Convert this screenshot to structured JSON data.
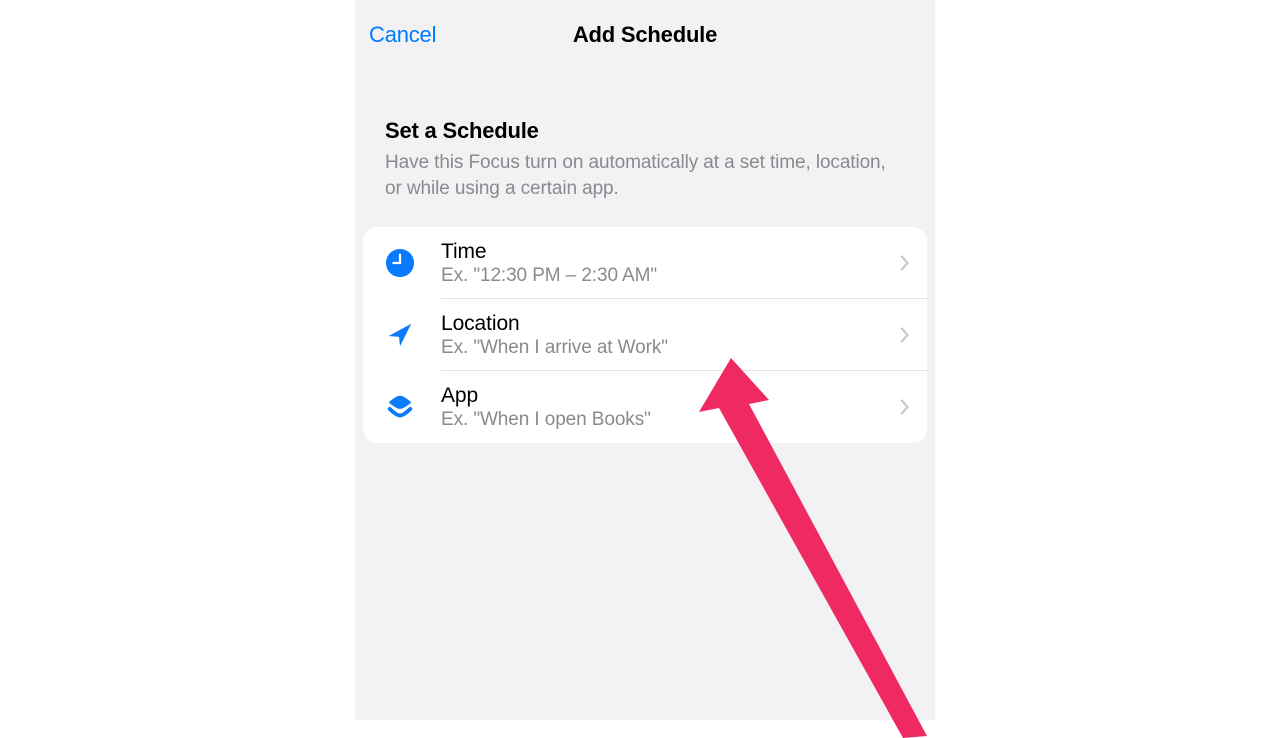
{
  "header": {
    "cancel_label": "Cancel",
    "title": "Add Schedule"
  },
  "section": {
    "title": "Set a Schedule",
    "description": "Have this Focus turn on automatically at a set time, location, or while using a certain app."
  },
  "rows": [
    {
      "title": "Time",
      "subtitle": "Ex. \"12:30 PM – 2:30 AM\"",
      "icon_name": "clock-icon"
    },
    {
      "title": "Location",
      "subtitle": "Ex. \"When I arrive at Work\"",
      "icon_name": "location-arrow-icon"
    },
    {
      "title": "App",
      "subtitle": "Ex. \"When I open Books\"",
      "icon_name": "layers-icon"
    }
  ],
  "colors": {
    "link": "#007aff",
    "icon": "#0a7bff",
    "bg": "#f2f2f5",
    "subtle": "#8a8a8e"
  },
  "annotation": {
    "arrow_color": "#ef2a62"
  }
}
